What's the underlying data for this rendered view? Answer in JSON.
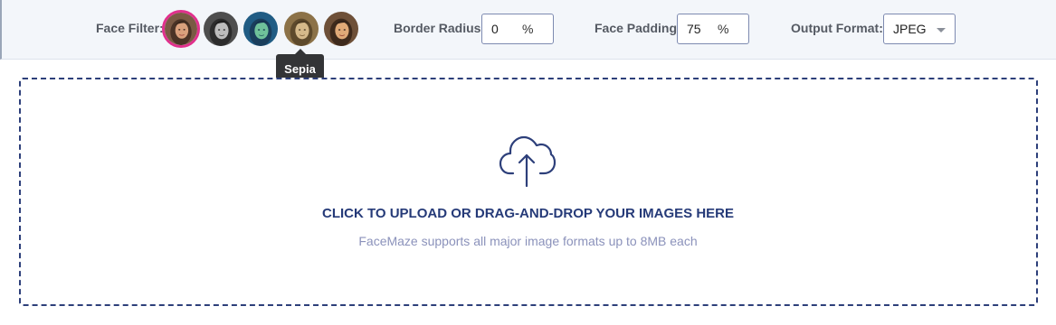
{
  "toolbar": {
    "face_filter_label": "Face Filter:",
    "filters": [
      {
        "name": "Original",
        "selected": true
      },
      {
        "name": "Grayscale",
        "selected": false
      },
      {
        "name": "Teal",
        "selected": false
      },
      {
        "name": "Sepia",
        "selected": false
      },
      {
        "name": "Warm",
        "selected": false
      }
    ],
    "tooltip": "Sepia",
    "border_radius_label": "Border Radius:",
    "border_radius_value": "0",
    "border_radius_unit": "%",
    "face_padding_label": "Face Padding:",
    "face_padding_value": "75",
    "face_padding_unit": "%",
    "output_format_label": "Output Format:",
    "output_format_value": "JPEG"
  },
  "dropzone": {
    "title": "CLICK TO UPLOAD OR DRAG-AND-DROP YOUR IMAGES HERE",
    "subtitle": "FaceMaze supports all major image formats up to 8MB each",
    "icon": "cloud-upload-icon"
  },
  "colors": {
    "accent_selected": "#e0308c",
    "dropzone_border": "#2d3f7a",
    "title": "#253a78",
    "subtitle": "#8b92bb"
  }
}
